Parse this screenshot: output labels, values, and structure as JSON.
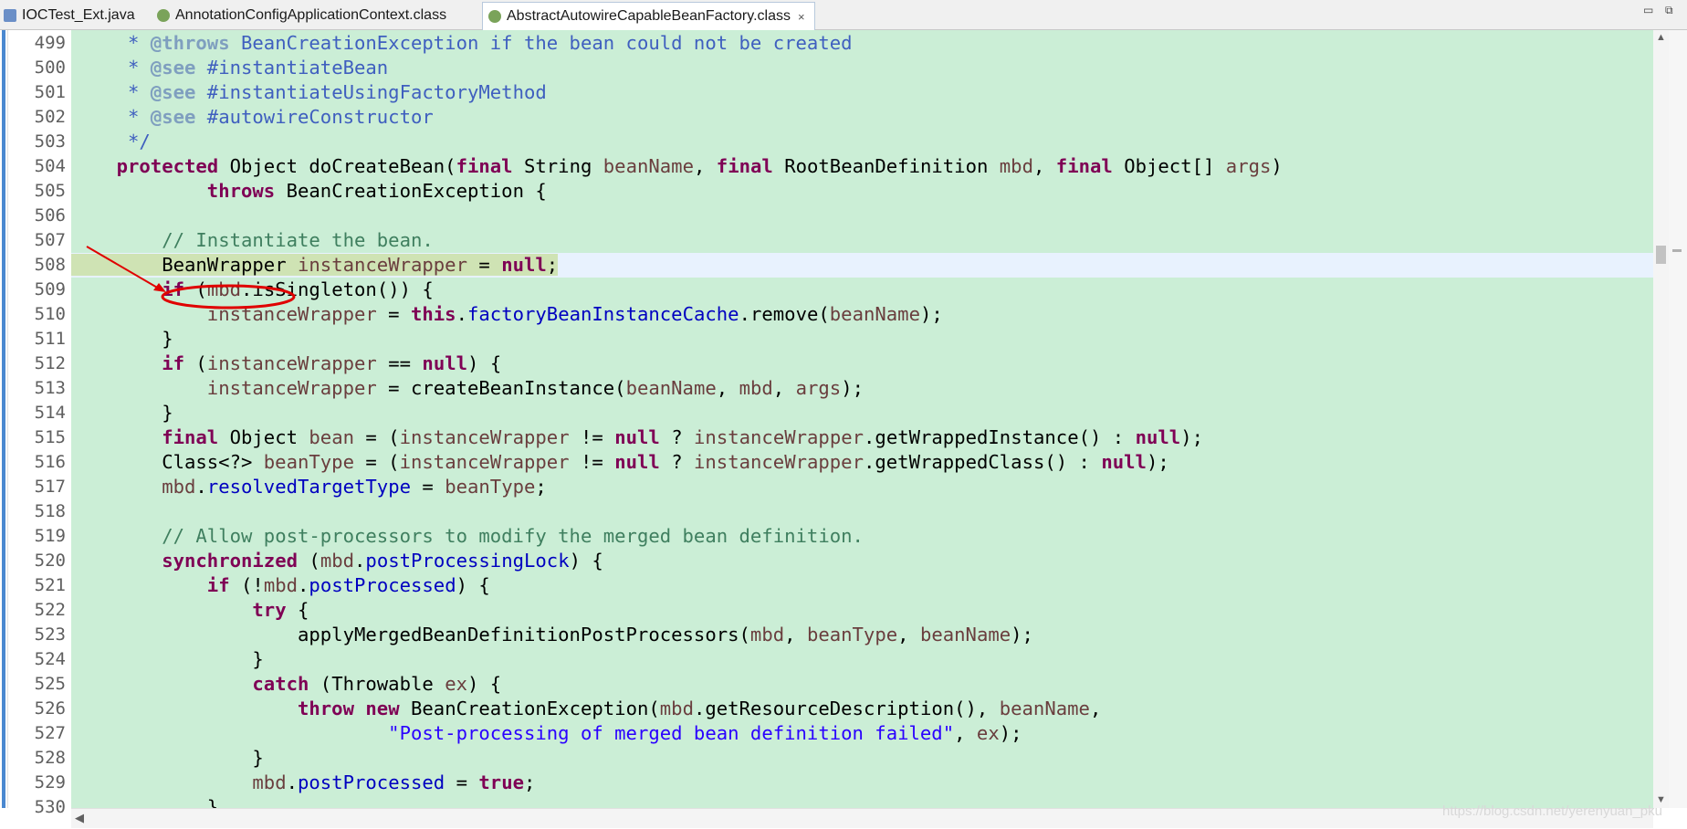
{
  "tabs": [
    {
      "label": "IOCTest_Ext.java",
      "icon": "java-file-icon"
    },
    {
      "label": "AnnotationConfigApplicationContext.class",
      "icon": "class-file-icon"
    },
    {
      "label": "AbstractAutowireCapableBeanFactory.class",
      "icon": "class-file-icon",
      "active": true,
      "close": "×"
    }
  ],
  "window_controls": {
    "minimize": "▭",
    "restore": "⧉"
  },
  "colors": {
    "keyword": "#7f0055",
    "comment": "#3f7f5f",
    "javadoc": "#3f5fbf",
    "javadoc_tag": "#7f9fbf",
    "field": "#0000c0",
    "local_variable": "#6a3e3e",
    "string": "#2a00ff",
    "editor_background": "#cbeed6",
    "annotation_red": "#e00000"
  },
  "line_numbers": [
    "499",
    "500",
    "501",
    "502",
    "503",
    "504",
    "505",
    "506",
    "507",
    "508",
    "509",
    "510",
    "511",
    "512",
    "513",
    "514",
    "515",
    "516",
    "517",
    "518",
    "519",
    "520",
    "521",
    "522",
    "523",
    "524",
    "525",
    "526",
    "527",
    "528",
    "529",
    "530"
  ],
  "code": {
    "l499": [
      "     * ",
      "@throws",
      " BeanCreationException if the bean could not be created"
    ],
    "l500": [
      "     * ",
      "@see",
      " #instantiateBean"
    ],
    "l501": [
      "     * ",
      "@see",
      " #instantiateUsingFactoryMethod"
    ],
    "l502": [
      "     * ",
      "@see",
      " #autowireConstructor"
    ],
    "l503": [
      "     */"
    ],
    "l504": [
      "    ",
      "protected",
      " Object doCreateBean(",
      "final",
      " String ",
      "beanName",
      ", ",
      "final",
      " RootBeanDefinition ",
      "mbd",
      ", ",
      "final",
      " Object[] ",
      "args",
      ")"
    ],
    "l505": [
      "            ",
      "throws",
      " BeanCreationException {"
    ],
    "l506": [
      ""
    ],
    "l507": [
      "        ",
      "// Instantiate the bean."
    ],
    "l508": [
      "        ",
      "BeanWrapper",
      " ",
      "instanceWrapper",
      " = ",
      "null",
      ";"
    ],
    "l509": [
      "        ",
      "if",
      " (",
      "mbd",
      ".isSingleton()) {"
    ],
    "l510": [
      "            ",
      "instanceWrapper",
      " = ",
      "this",
      ".",
      "factoryBeanInstanceCache",
      ".remove(",
      "beanName",
      ");"
    ],
    "l511": [
      "        }"
    ],
    "l512": [
      "        ",
      "if",
      " (",
      "instanceWrapper",
      " == ",
      "null",
      ") {"
    ],
    "l513": [
      "            ",
      "instanceWrapper",
      " = createBeanInstance(",
      "beanName",
      ", ",
      "mbd",
      ", ",
      "args",
      ");"
    ],
    "l514": [
      "        }"
    ],
    "l515": [
      "        ",
      "final",
      " Object ",
      "bean",
      " = (",
      "instanceWrapper",
      " != ",
      "null",
      " ? ",
      "instanceWrapper",
      ".getWrappedInstance() : ",
      "null",
      ");"
    ],
    "l516": [
      "        Class<?> ",
      "beanType",
      " = (",
      "instanceWrapper",
      " != ",
      "null",
      " ? ",
      "instanceWrapper",
      ".getWrappedClass() : ",
      "null",
      ");"
    ],
    "l517": [
      "        ",
      "mbd",
      ".",
      "resolvedTargetType",
      " = ",
      "beanType",
      ";"
    ],
    "l518": [
      ""
    ],
    "l519": [
      "        ",
      "// Allow post-processors to modify the merged bean definition."
    ],
    "l520": [
      "        ",
      "synchronized",
      " (",
      "mbd",
      ".",
      "postProcessingLock",
      ") {"
    ],
    "l521": [
      "            ",
      "if",
      " (!",
      "mbd",
      ".",
      "postProcessed",
      ") {"
    ],
    "l522": [
      "                ",
      "try",
      " {"
    ],
    "l523": [
      "                    applyMergedBeanDefinitionPostProcessors(",
      "mbd",
      ", ",
      "beanType",
      ", ",
      "beanName",
      ");"
    ],
    "l524": [
      "                }"
    ],
    "l525": [
      "                ",
      "catch",
      " (Throwable ",
      "ex",
      ") {"
    ],
    "l526": [
      "                    ",
      "throw",
      " ",
      "new",
      " BeanCreationException(",
      "mbd",
      ".getResourceDescription(), ",
      "beanName",
      ","
    ],
    "l527": [
      "                            ",
      "\"Post-processing of merged bean definition failed\"",
      ", ",
      "ex",
      ");"
    ],
    "l528": [
      "                }"
    ],
    "l529": [
      "                ",
      "mbd",
      ".",
      "postProcessed",
      " = ",
      "true",
      ";"
    ],
    "l530": [
      "            }"
    ]
  },
  "watermark": "https://blog.csdn.net/yerenyuan_pku"
}
